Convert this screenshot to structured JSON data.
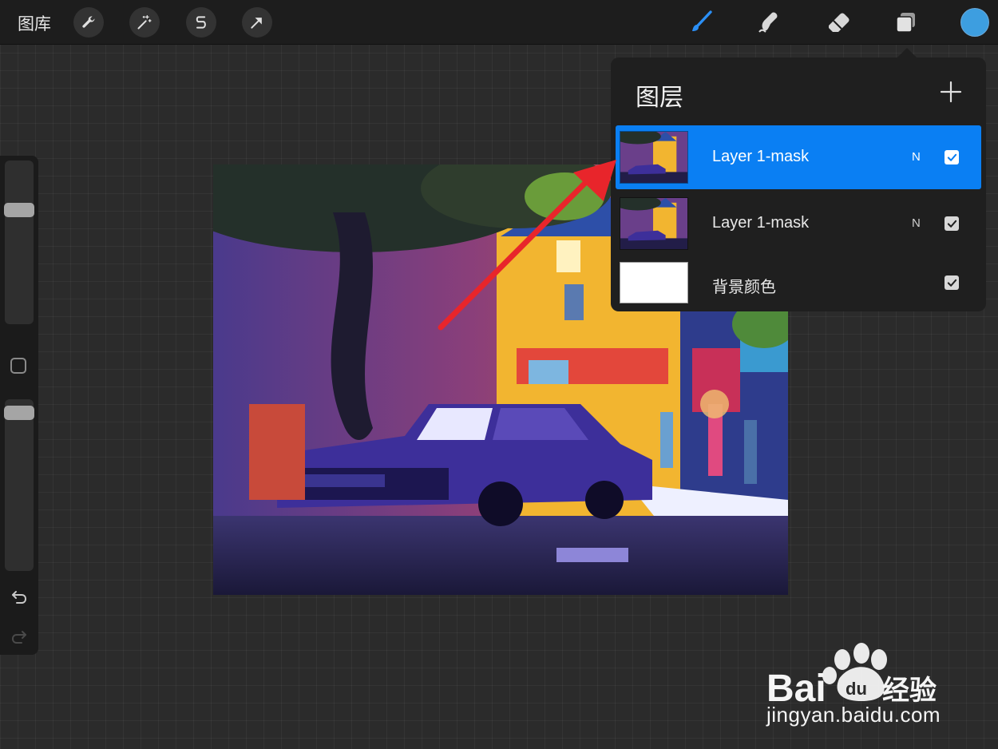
{
  "toolbar": {
    "gallery_label": "图库",
    "left_tools": [
      "wrench-icon",
      "magic-wand-icon",
      "selection-icon",
      "transform-arrow-icon"
    ],
    "right_tools": [
      "brush-icon",
      "smudge-icon",
      "eraser-icon",
      "layers-icon"
    ],
    "current_color": "#3d9ee0",
    "accent_color": "#0a7ff3"
  },
  "sidebar": {
    "brush_size_level": 0.72,
    "opacity_level": 0.97
  },
  "layers_panel": {
    "title": "图层",
    "layers": [
      {
        "name": "Layer 1-mask",
        "blend": "N",
        "visible": true,
        "active": true
      },
      {
        "name": "Layer 1-mask",
        "blend": "N",
        "visible": true,
        "active": false
      },
      {
        "name": "背景颜色",
        "blend": "",
        "visible": true,
        "active": false
      }
    ]
  },
  "watermark": {
    "brand": "Bai",
    "brand_suffix": "du",
    "product": "经验",
    "url": "jingyan.baidu.com"
  }
}
